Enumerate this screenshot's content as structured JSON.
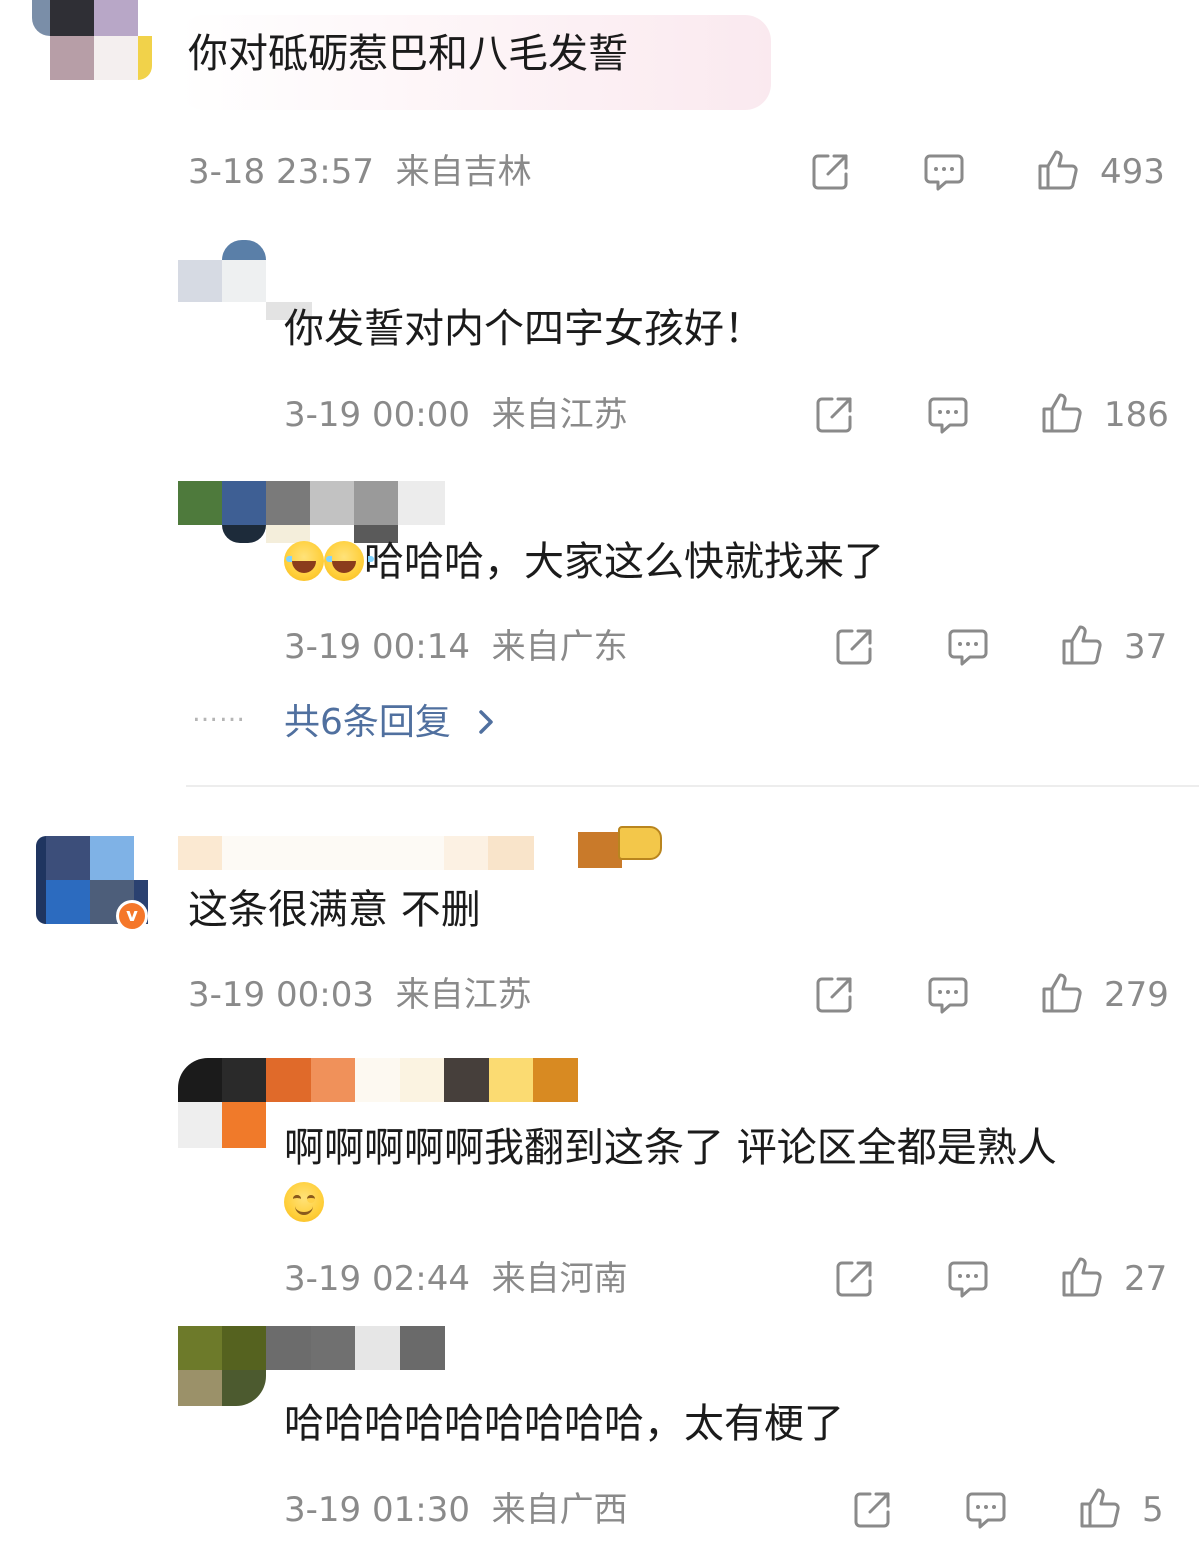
{
  "comments": [
    {
      "text": "你对砥砺惹巴和八毛发誓",
      "time": "3-18 23:57",
      "location": "来自吉林",
      "likes": "493",
      "replies": [
        {
          "text": "你发誓对内个四字女孩好！",
          "time": "3-19 00:00",
          "location": "来自江苏",
          "likes": "186"
        },
        {
          "emoji": "laugh-cry-emoji",
          "text": "哈哈哈，大家这么快就找来了",
          "time": "3-19 00:14",
          "location": "来自广东",
          "likes": "37"
        }
      ],
      "more_replies": {
        "dots": "……",
        "label": "共6条回复"
      }
    },
    {
      "text": "这条很满意 不删",
      "time": "3-19 00:03",
      "location": "来自江苏",
      "likes": "279",
      "verified_badge": "v",
      "replies": [
        {
          "text": "啊啊啊啊啊我翻到这条了 评论区全都是熟人",
          "emoji": "smile-emoji",
          "time": "3-19 02:44",
          "location": "来自河南",
          "likes": "27"
        },
        {
          "text": "哈哈哈哈哈哈哈哈哈，太有梗了",
          "time": "3-19 01:30",
          "location": "来自广西",
          "likes": "5"
        }
      ]
    }
  ],
  "icons": {
    "share": "share-icon",
    "comment": "comment-icon",
    "like": "thumbs-up-icon",
    "chevron": "chevron-right-icon"
  },
  "colors": {
    "link": "#50709f",
    "meta": "#8a8a8a",
    "badge": "#f5772a"
  }
}
